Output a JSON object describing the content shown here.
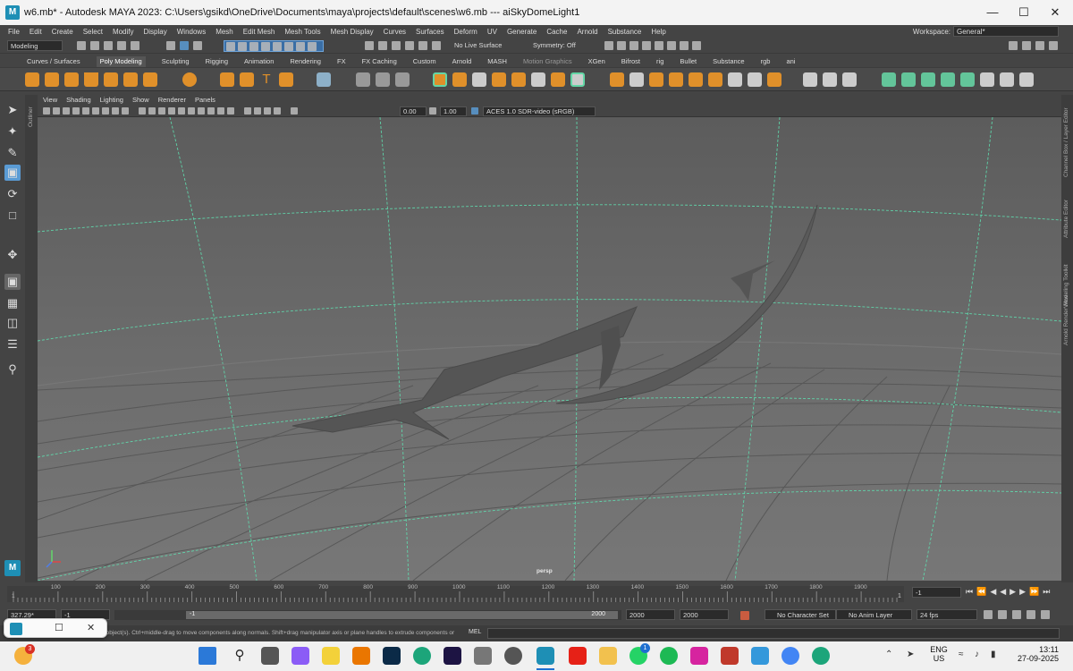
{
  "window": {
    "title": "w6.mb* - Autodesk MAYA 2023: C:\\Users\\gsikd\\OneDrive\\Documents\\maya\\projects\\default\\scenes\\w6.mb   ---   aiSkyDomeLight1",
    "app_icon_label": "M"
  },
  "menubar": {
    "items": [
      "File",
      "Edit",
      "Create",
      "Select",
      "Modify",
      "Display",
      "Windows",
      "Mesh",
      "Edit Mesh",
      "Mesh Tools",
      "Mesh Display",
      "Curves",
      "Surfaces",
      "Deform",
      "UV",
      "Generate",
      "Cache",
      "Arnold",
      "Substance",
      "Help"
    ],
    "workspace_label": "Workspace:",
    "workspace_value": "General*"
  },
  "statusline": {
    "mode": "Modeling",
    "live_surface": "No Live Surface",
    "symmetry": "Symmetry: Off"
  },
  "shelf": {
    "tabs": [
      "Curves / Surfaces",
      "Poly Modeling",
      "Sculpting",
      "Rigging",
      "Animation",
      "Rendering",
      "FX",
      "FX Caching",
      "Custom",
      "Arnold",
      "MASH",
      "Motion Graphics",
      "XGen",
      "Bifrost",
      "rig",
      "Bullet",
      "Substance",
      "rgb",
      "ani"
    ],
    "active_tab": "Poly Modeling"
  },
  "panel": {
    "menus": [
      "View",
      "Shading",
      "Lighting",
      "Show",
      "Renderer",
      "Panels"
    ],
    "exposure": "0.00",
    "gamma": "1.00",
    "color_space": "ACES 1.0 SDR-video (sRGB)",
    "camera_label": "persp"
  },
  "side_tabs": {
    "left": "Outliner",
    "right": [
      "Channel Box / Layer Editor",
      "Attribute Editor",
      "Modeling Toolkit",
      "Arnold RenderView"
    ]
  },
  "timeline": {
    "ticks": [
      "1",
      "100",
      "200",
      "300",
      "400",
      "500",
      "600",
      "700",
      "800",
      "900",
      "1000",
      "1100",
      "1200",
      "1300",
      "1400",
      "1500",
      "1600",
      "1700",
      "1800",
      "1900"
    ],
    "end_tick": "1",
    "current_frame": "-1"
  },
  "range": {
    "start": "-1",
    "range_start": "-1",
    "range_end": "2000",
    "end": "2000",
    "end2": "2000",
    "char_set": "No Character Set",
    "anim_layer": "No Anim Layer",
    "fps": "24 fps",
    "current_time": "327.29*"
  },
  "helpline": {
    "text": "ve object(s). Ctrl+middle-drag to move components along normals. Shift+drag manipulator axis or plane handles to extrude components or c",
    "mel_label": "MEL"
  },
  "taskbar": {
    "badge_count": "3",
    "whatsapp_badge": "1",
    "lang": "ENG",
    "region": "US",
    "time": "13:11",
    "date": "27-09-2025"
  },
  "colors": {
    "viewport_bg": "#6b6b6b",
    "grid_line": "#5a5a5a",
    "grid_axis": "#63d6a6",
    "mesh": "#555555"
  }
}
